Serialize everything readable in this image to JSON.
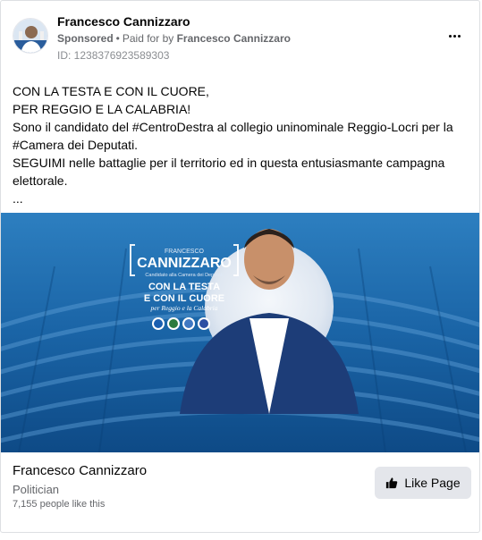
{
  "post": {
    "author": "Francesco Cannizzaro",
    "sponsored": "Sponsored",
    "separator": "•",
    "paid_for_prefix": "Paid for by",
    "paid_for_name": "Francesco Cannizzaro",
    "id_label": "ID: 1238376923589303",
    "body_lines": [
      "CON LA TESTA E CON IL CUORE,",
      "PER REGGIO E LA CALABRIA!",
      "Sono il candidato del #CentroDestra al collegio uninominale Reggio-Locri per la",
      "#Camera dei Deputati.",
      "SEGUIMI nelle battaglie per il territorio ed in questa entusiasmante campagna",
      "elettorale.",
      "..."
    ]
  },
  "ad_image": {
    "small_name": "FRANCESCO",
    "big_name": "CANNIZZARO",
    "role": "Candidato alla Camera dei Deputati",
    "slogan_line1": "CON LA TESTA",
    "slogan_line2": "E CON IL CUORE",
    "slogan_sub": "per Reggio e la Calabria"
  },
  "footer": {
    "page_name": "Francesco Cannizzaro",
    "category": "Politician",
    "likes": "7,155 people like this",
    "like_button": "Like Page"
  },
  "colors": {
    "accent_blue": "#1a6fb0",
    "muted_text": "#65676b",
    "button_bg": "#e4e6eb"
  },
  "icons": [
    "more-options-icon",
    "thumbs-up-icon"
  ]
}
